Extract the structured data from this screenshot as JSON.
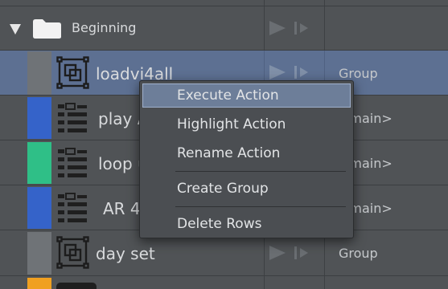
{
  "group_header": {
    "label": "Beginning",
    "expand_icon": "triangle-down-icon",
    "folder_icon": "folder-icon"
  },
  "rows": [
    {
      "name": "loadvi4all",
      "type": "Group",
      "color": "#6f7377",
      "icon": "group-frame-icon",
      "selected": true
    },
    {
      "name": "play A",
      "type": "<main>",
      "color": "#3563c9",
      "icon": "action-list-icon"
    },
    {
      "name": "loop u",
      "type": "<main>",
      "color": "#2fbf87",
      "icon": "action-list-icon"
    },
    {
      "name": "AR 4",
      "type": "<main>",
      "color": "#3563c9",
      "icon": "action-list-icon"
    },
    {
      "name": "day set",
      "type": "Group",
      "color": "#6f7377",
      "icon": "group-frame-icon"
    }
  ],
  "partial_row_color": "#f0a020",
  "context_menu": {
    "items": [
      {
        "label": "Execute Action",
        "selected": true
      },
      {
        "label": "Highlight Action"
      },
      {
        "label": "Rename Action"
      },
      {
        "label": "Create Group"
      },
      {
        "label": "Delete Rows"
      }
    ]
  }
}
